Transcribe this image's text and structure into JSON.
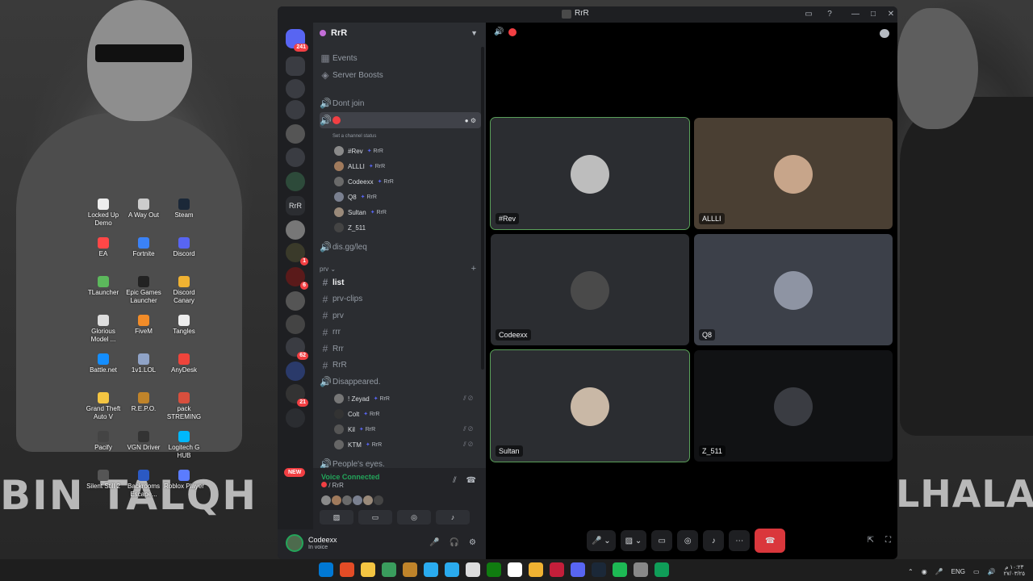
{
  "window": {
    "title": "RrR"
  },
  "desktop": {
    "brand_left": "BIN TALQH",
    "brand_right": "LHALAFI",
    "icons": [
      {
        "label": "Locked Up Demo",
        "color": "#eeeeee"
      },
      {
        "label": "A Way Out",
        "color": "#cccccc"
      },
      {
        "label": "Steam",
        "color": "#1b2838"
      },
      {
        "label": "EA",
        "color": "#ff4747"
      },
      {
        "label": "Fortnite",
        "color": "#3b82f6"
      },
      {
        "label": "Discord",
        "color": "#5865f2"
      },
      {
        "label": "TLauncher",
        "color": "#5cb85c"
      },
      {
        "label": "Epic Games Launcher",
        "color": "#222222"
      },
      {
        "label": "Discord Canary",
        "color": "#f0b232"
      },
      {
        "label": "Glorious Model ...",
        "color": "#dddddd"
      },
      {
        "label": "FiveM",
        "color": "#f28c28"
      },
      {
        "label": "Tangles",
        "color": "#eeeeee"
      },
      {
        "label": "Battle.net",
        "color": "#148eff"
      },
      {
        "label": "1v1.LOL",
        "color": "#8fa3c7"
      },
      {
        "label": "AnyDesk",
        "color": "#ef443b"
      },
      {
        "label": "Grand Theft Auto V",
        "color": "#f4c542"
      },
      {
        "label": "R.E.P.O.",
        "color": "#c0842a"
      },
      {
        "label": "pack STREMING",
        "color": "#d94f3d"
      },
      {
        "label": "Pacify",
        "color": "#444444"
      },
      {
        "label": "VGN Driver",
        "color": "#333333"
      },
      {
        "label": "Logitech G HUB",
        "color": "#00b8fc"
      },
      {
        "label": "Silent Still 2",
        "color": "#555555"
      },
      {
        "label": "Backrooms Escape...",
        "color": "#2b59c3"
      },
      {
        "label": "Roblox Player",
        "color": "#5b7cff"
      }
    ]
  },
  "servers": {
    "top_badge": "241",
    "badges": [
      "1",
      "6",
      "62",
      "21"
    ],
    "rrr_label": "RrR",
    "new_label": "NEW"
  },
  "sidebar": {
    "guild_name": "RrR",
    "events": "Events",
    "boosts": "Server Boosts",
    "channels_top": [
      {
        "name": "Dont join"
      },
      {
        "name": "dis.gg/leq"
      }
    ],
    "status_placeholder": "Set a channel status",
    "voice_members": [
      {
        "name": "#Rev",
        "tag": "RrR",
        "color": "#8a8a8a"
      },
      {
        "name": "ALLLI",
        "tag": "RrR",
        "color": "#a07a5c"
      },
      {
        "name": "Codeexx",
        "tag": "RrR",
        "color": "#6a6a6a"
      },
      {
        "name": "Q8",
        "tag": "RrR",
        "color": "#7a8090"
      },
      {
        "name": "Sultan",
        "tag": "RrR",
        "color": "#9a8a7a"
      },
      {
        "name": "Z_511",
        "tag": "",
        "color": "#444444"
      }
    ],
    "category": "prv",
    "text_channels": [
      {
        "name": "list"
      },
      {
        "name": "prv-clips"
      },
      {
        "name": "prv"
      },
      {
        "name": "rrr"
      },
      {
        "name": "Rrr"
      },
      {
        "name": "RrR"
      }
    ],
    "disappeared": "Disappeared.",
    "disappeared_members": [
      {
        "name": "! Zeyad",
        "tag": "RrR",
        "color": "#777777"
      },
      {
        "name": "Colt",
        "tag": "RrR",
        "color": "#333333"
      },
      {
        "name": "Kil",
        "tag": "RrR",
        "color": "#555555"
      },
      {
        "name": "KTM",
        "tag": "RrR",
        "color": "#666666"
      }
    ],
    "peoples_eyes": "People's eyes."
  },
  "voice_panel": {
    "title": "Voice Connected",
    "channel": "/ RrR"
  },
  "user": {
    "name": "Codeexx",
    "status": "In voice"
  },
  "call": {
    "tiles": [
      {
        "name": "#Rev",
        "bg": "#2b2d31",
        "avatar": "#bdbdbd",
        "speaking": true
      },
      {
        "name": "ALLLI",
        "bg": "#4a3f33",
        "avatar": "#c7a58a",
        "speaking": false
      },
      {
        "name": "Codeexx",
        "bg": "#2b2d31",
        "avatar": "#4a4a4a",
        "speaking": false
      },
      {
        "name": "Q8",
        "bg": "#3c4049",
        "avatar": "#8e94a3",
        "speaking": false
      },
      {
        "name": "Sultan",
        "bg": "#2b2d31",
        "avatar": "#c9b8a6",
        "speaking": true
      },
      {
        "name": "Z_511",
        "bg": "#111214",
        "avatar": "#3a3c42",
        "speaking": false
      }
    ]
  },
  "taskbar": {
    "lang": "ENG",
    "time": "١٠:٢٣ م",
    "date": "٢٧/٠٣/٢٥",
    "apps": [
      "#0078d4",
      "#e34c26",
      "#f4c542",
      "#3a9d5d",
      "#c0842a",
      "#2aabee",
      "#2aabee",
      "#dddddd",
      "#107c10",
      "#ffffff",
      "#f0b232",
      "#c41e3a",
      "#5865f2",
      "#1b2838",
      "#1db954",
      "#888888",
      "#0f9d58"
    ]
  }
}
